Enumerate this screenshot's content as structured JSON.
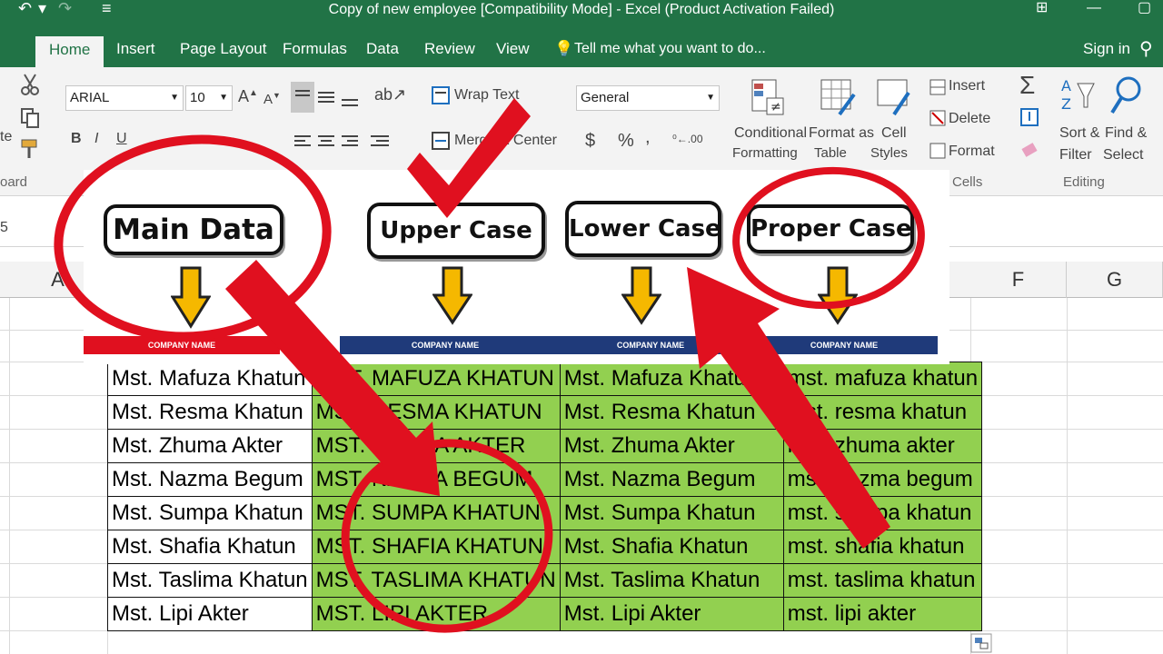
{
  "window": {
    "title": "Copy of new employee  [Compatibility Mode] - Excel (Product Activation Failed)"
  },
  "tabs": [
    "Home",
    "Insert",
    "Page Layout",
    "Formulas",
    "Data",
    "Review",
    "View"
  ],
  "tell_me": "Tell me what you want to do...",
  "sign_in": "Sign in",
  "ribbon": {
    "font_name": "ARIAL",
    "font_size": "10",
    "bold": "B",
    "italic": "I",
    "underline": "U",
    "wrap_text": "Wrap Text",
    "merge_center": "Merge & Center",
    "number_format": "General",
    "currency": "$",
    "percent": "%",
    "comma": ",",
    "conditional_formatting": "Conditional",
    "conditional_formatting_2": "Formatting",
    "format_as_table": "Format as",
    "format_as_table_2": "Table",
    "cell_styles": "Cell",
    "cell_styles_2": "Styles",
    "insert": "Insert",
    "delete": "Delete",
    "format": "Format",
    "cells_group": "Cells",
    "sort_filter": "Sort &",
    "sort_filter_2": "Filter",
    "find_select": "Find &",
    "find_select_2": "Select",
    "editing_group": "Editing",
    "clipboard_group": "oard",
    "paste_partial": "te"
  },
  "formula_bar": {
    "name_box_partial": "5"
  },
  "columns": {
    "a": "A",
    "f": "F",
    "g": "G"
  },
  "banner": {
    "main_data": "Main Data",
    "upper_case": "Upper Case",
    "lower_case": "Lower Case",
    "proper_case": "Proper Case",
    "strip_label": "COMPANY NAME"
  },
  "table": {
    "rows": [
      [
        "Mst. Mafuza Khatun",
        "MST. MAFUZA KHATUN",
        "Mst. Mafuza Khatun",
        "mst. mafuza khatun"
      ],
      [
        "Mst. Resma Khatun",
        "MST. RESMA KHATUN",
        "Mst. Resma Khatun",
        "mst. resma khatun"
      ],
      [
        "Mst. Zhuma Akter",
        "MST. ZHUMA AKTER",
        "Mst. Zhuma Akter",
        "mst. zhuma akter"
      ],
      [
        "Mst. Nazma Begum",
        "MST. NAZMA BEGUM",
        "Mst. Nazma Begum",
        "mst. nazma begum"
      ],
      [
        "Mst. Sumpa Khatun",
        "MST. SUMPA KHATUN",
        "Mst. Sumpa Khatun",
        "mst. sumpa khatun"
      ],
      [
        "Mst. Shafia Khatun",
        "MST. SHAFIA KHATUN",
        "Mst. Shafia Khatun",
        "mst. shafia khatun"
      ],
      [
        "Mst. Taslima Khatun",
        "MST. TASLIMA KHATUN",
        "Mst. Taslima Khatun",
        "mst. taslima khatun"
      ],
      [
        "Mst. Lipi Akter",
        "MST. LIPI AKTER",
        "Mst. Lipi Akter",
        "mst. lipi akter"
      ]
    ]
  },
  "colors": {
    "excel_green": "#217346",
    "cell_green": "#92d050",
    "annotation_red": "#e0101f",
    "arrow_yellow": "#f5b800",
    "strip_navy": "#1f3a7a"
  }
}
